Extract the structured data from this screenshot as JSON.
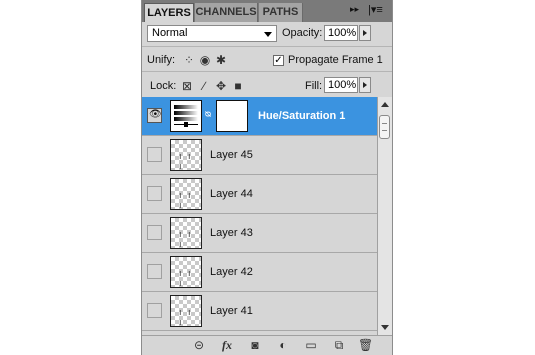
{
  "tabs": [
    {
      "label": "LAYERS"
    },
    {
      "label": "CHANNELS"
    },
    {
      "label": "PATHS"
    }
  ],
  "blend_mode": "Normal",
  "opacity": {
    "label": "Opacity:",
    "value": "100%"
  },
  "unify": {
    "label": "Unify:"
  },
  "propagate": {
    "label": "Propagate Frame 1",
    "checked": true
  },
  "lock": {
    "label": "Lock:"
  },
  "fill": {
    "label": "Fill:",
    "value": "100%"
  },
  "layers": [
    {
      "name": "Hue/Saturation 1",
      "selected": true,
      "visible": true
    },
    {
      "name": "Layer 45",
      "visible": false
    },
    {
      "name": "Layer 44",
      "visible": false
    },
    {
      "name": "Layer 43",
      "visible": false
    },
    {
      "name": "Layer 42",
      "visible": false
    },
    {
      "name": "Layer 41",
      "visible": false
    }
  ],
  "colors": {
    "selection": "#3b93e0",
    "panel": "#d6d6d6",
    "tabbar": "#7a7a7a"
  }
}
